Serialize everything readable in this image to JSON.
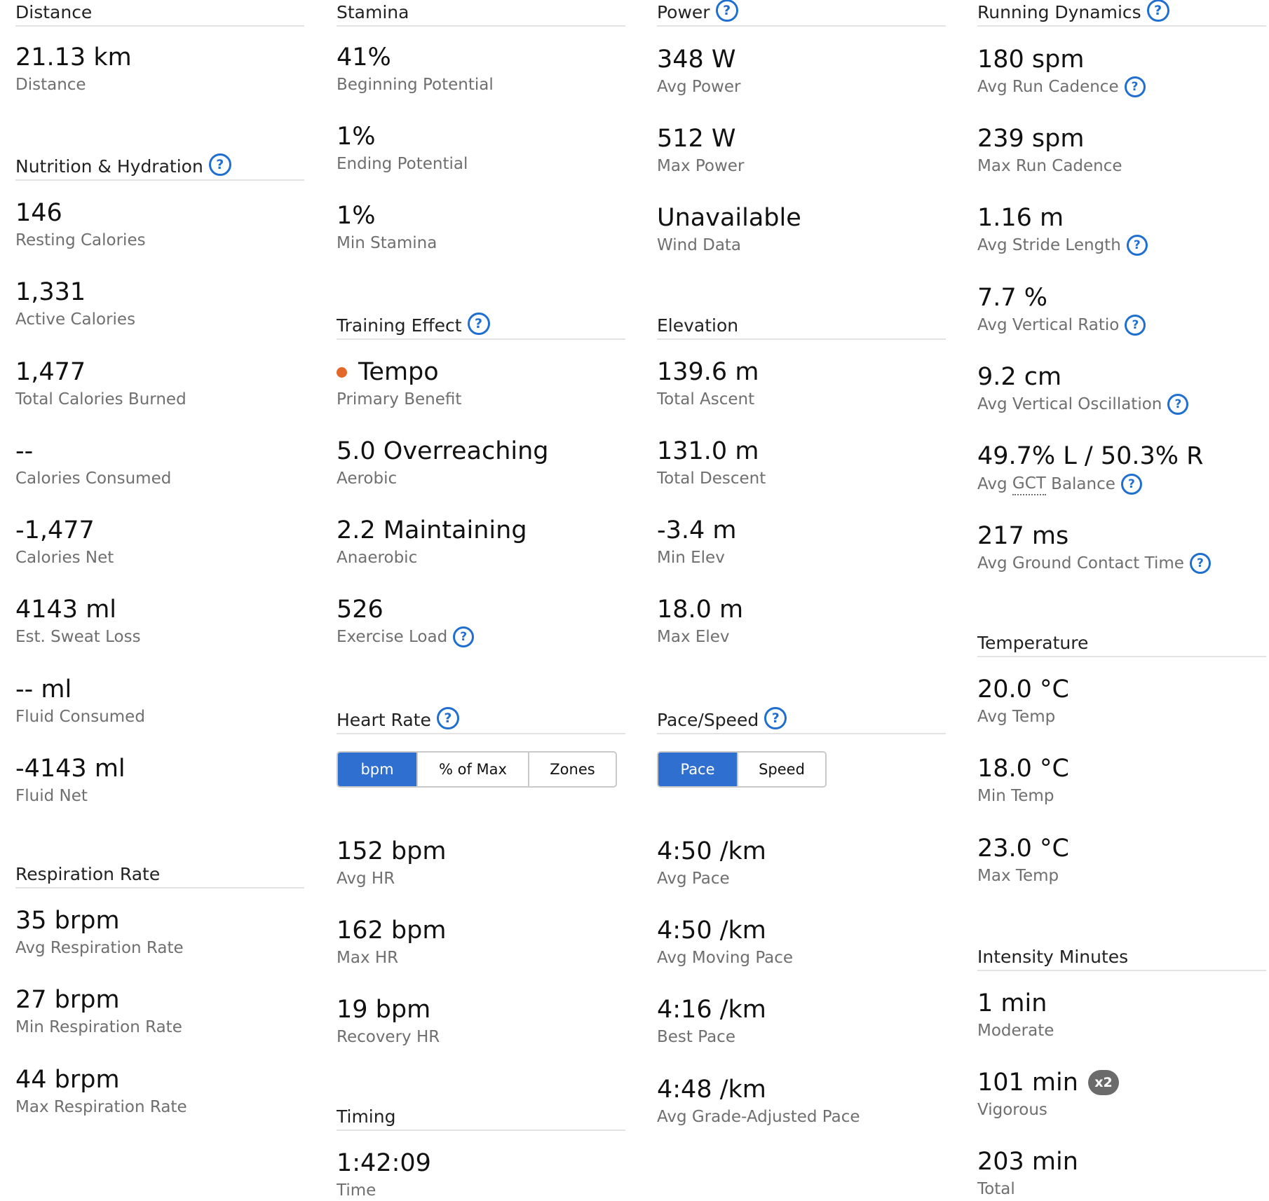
{
  "col1": {
    "distance": {
      "title": "Distance",
      "metrics": [
        {
          "value": "21.13 km",
          "label": "Distance"
        }
      ]
    },
    "nutrition": {
      "title": "Nutrition & Hydration",
      "metrics": [
        {
          "value": "146",
          "label": "Resting Calories"
        },
        {
          "value": "1,331",
          "label": "Active Calories"
        },
        {
          "value": "1,477",
          "label": "Total Calories Burned"
        },
        {
          "value": "--",
          "label": "Calories Consumed"
        },
        {
          "value": "-1,477",
          "label": "Calories Net"
        },
        {
          "value": "4143 ml",
          "label": "Est. Sweat Loss"
        },
        {
          "value": "-- ml",
          "label": "Fluid Consumed"
        },
        {
          "value": "-4143 ml",
          "label": "Fluid Net"
        }
      ]
    },
    "respiration": {
      "title": "Respiration Rate",
      "metrics": [
        {
          "value": "35 brpm",
          "label": "Avg Respiration Rate"
        },
        {
          "value": "27 brpm",
          "label": "Min Respiration Rate"
        },
        {
          "value": "44 brpm",
          "label": "Max Respiration Rate"
        }
      ]
    }
  },
  "col2": {
    "stamina": {
      "title": "Stamina",
      "metrics": [
        {
          "value": "41%",
          "label": "Beginning Potential"
        },
        {
          "value": "1%",
          "label": "Ending Potential"
        },
        {
          "value": "1%",
          "label": "Min Stamina"
        }
      ]
    },
    "training_effect": {
      "title": "Training Effect",
      "metrics": [
        {
          "value": "Tempo",
          "label": "Primary Benefit"
        },
        {
          "value": "5.0 Overreaching",
          "label": "Aerobic"
        },
        {
          "value": "2.2 Maintaining",
          "label": "Anaerobic"
        },
        {
          "value": "526",
          "label": "Exercise Load"
        }
      ]
    },
    "heart_rate": {
      "title": "Heart Rate",
      "toggle": [
        "bpm",
        "% of Max",
        "Zones"
      ],
      "selected": "bpm",
      "metrics": [
        {
          "value": "152 bpm",
          "label": "Avg HR"
        },
        {
          "value": "162 bpm",
          "label": "Max HR"
        },
        {
          "value": "19 bpm",
          "label": "Recovery HR"
        }
      ]
    },
    "timing": {
      "title": "Timing",
      "metrics": [
        {
          "value": "1:42:09",
          "label": "Time"
        }
      ]
    }
  },
  "col3": {
    "power": {
      "title": "Power",
      "metrics": [
        {
          "value": "348 W",
          "label": "Avg Power"
        },
        {
          "value": "512 W",
          "label": "Max Power"
        },
        {
          "value": "Unavailable",
          "label": "Wind Data"
        }
      ]
    },
    "elevation": {
      "title": "Elevation",
      "metrics": [
        {
          "value": "139.6 m",
          "label": "Total Ascent"
        },
        {
          "value": "131.0 m",
          "label": "Total Descent"
        },
        {
          "value": "-3.4 m",
          "label": "Min Elev"
        },
        {
          "value": "18.0 m",
          "label": "Max Elev"
        }
      ]
    },
    "pace": {
      "title": "Pace/Speed",
      "toggle": [
        "Pace",
        "Speed"
      ],
      "selected": "Pace",
      "metrics": [
        {
          "value": "4:50 /km",
          "label": "Avg Pace"
        },
        {
          "value": "4:50 /km",
          "label": "Avg Moving Pace"
        },
        {
          "value": "4:16 /km",
          "label": "Best Pace"
        },
        {
          "value": "4:48 /km",
          "label": "Avg Grade-Adjusted Pace"
        }
      ]
    }
  },
  "col4": {
    "dynamics": {
      "title": "Running Dynamics",
      "metrics": [
        {
          "value": "180 spm",
          "label": "Avg Run Cadence"
        },
        {
          "value": "239 spm",
          "label": "Max Run Cadence"
        },
        {
          "value": "1.16 m",
          "label": "Avg Stride Length"
        },
        {
          "value": "7.7 %",
          "label": "Avg Vertical Ratio"
        },
        {
          "value": "9.2 cm",
          "label": "Avg Vertical Oscillation"
        },
        {
          "value": "49.7% L / 50.3% R",
          "label_a": "Avg",
          "label_b": "GCT",
          "label_c": "Balance"
        },
        {
          "value": "217 ms",
          "label": "Avg Ground Contact Time"
        }
      ]
    },
    "temperature": {
      "title": "Temperature",
      "metrics": [
        {
          "value": "20.0 °C",
          "label": "Avg Temp"
        },
        {
          "value": "18.0 °C",
          "label": "Min Temp"
        },
        {
          "value": "23.0 °C",
          "label": "Max Temp"
        }
      ]
    },
    "intensity": {
      "title": "Intensity Minutes",
      "badge": "x2",
      "metrics": [
        {
          "value": "1 min",
          "label": "Moderate"
        },
        {
          "value": "101 min",
          "label": "Vigorous"
        },
        {
          "value": "203 min",
          "label": "Total"
        }
      ]
    }
  },
  "help_glyph": "?",
  "colors": {
    "accent": "#2f6fcf",
    "help": "#1f6fd1",
    "tempo_dot": "#e3692a",
    "divider": "#e3e3e3",
    "label": "#6f6f6f"
  }
}
